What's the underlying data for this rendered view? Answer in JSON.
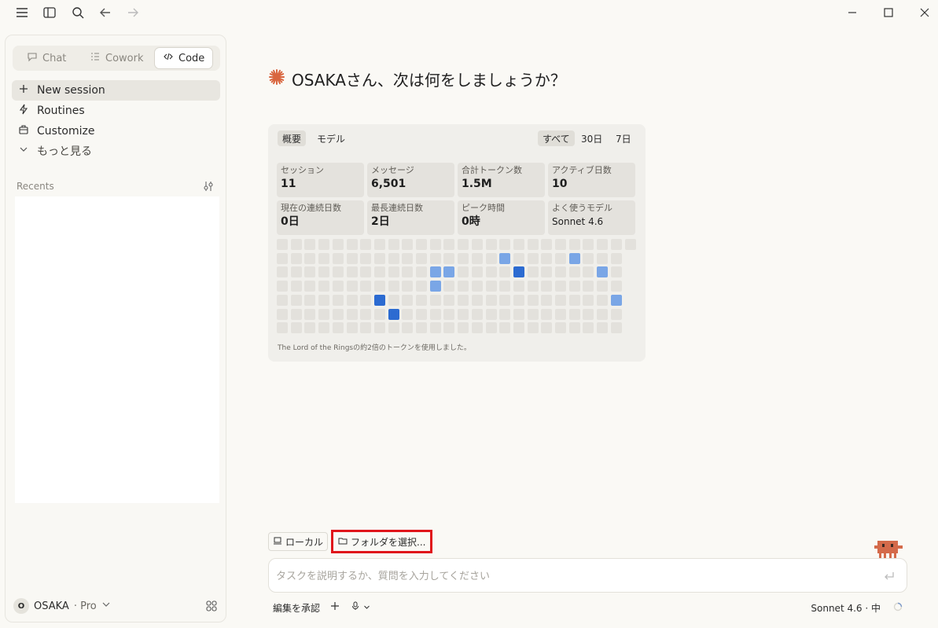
{
  "sidebar": {
    "modes": [
      {
        "label": "Chat",
        "icon": "chat-icon",
        "active": false
      },
      {
        "label": "Cowork",
        "icon": "cowork-icon",
        "active": false
      },
      {
        "label": "Code",
        "icon": "code-icon",
        "active": true
      }
    ],
    "items": [
      {
        "label": "New session",
        "icon": "plus-icon"
      },
      {
        "label": "Routines",
        "icon": "lightning-icon"
      },
      {
        "label": "Customize",
        "icon": "briefcase-icon"
      },
      {
        "label": "もっと見る",
        "icon": "chevron-down-icon"
      }
    ],
    "recents_label": "Recents",
    "user": {
      "initial": "O",
      "name": "OSAKA",
      "plan": "· Pro"
    }
  },
  "greeting": "OSAKAさん、次は何をしましょうか？",
  "stats": {
    "tabs_left": [
      "概要",
      "モデル"
    ],
    "tabs_right": [
      "すべて",
      "30日",
      "7日"
    ],
    "boxes": [
      {
        "label": "セッション",
        "value": "11"
      },
      {
        "label": "メッセージ",
        "value": "6,501"
      },
      {
        "label": "合計トークン数",
        "value": "1.5M"
      },
      {
        "label": "アクティブ日数",
        "value": "10"
      },
      {
        "label": "現在の連続日数",
        "value": "0日"
      },
      {
        "label": "最長連続日数",
        "value": "2日"
      },
      {
        "label": "ピーク時間",
        "value": "0時"
      },
      {
        "label": "よく使うモデル",
        "value": "Sonnet 4.6"
      }
    ],
    "footnote": "The Lord of the Ringsの約2倍のトークンを使用しました。",
    "colors": {
      "empty": "#e3e1dc",
      "light": "#7aa6e6",
      "dark": "#2c6bd1"
    }
  },
  "env": {
    "local_label": "ローカル",
    "folder_label": "フォルダを選択..."
  },
  "composer": {
    "placeholder": "タスクを説明するか、質問を入力してください"
  },
  "bottom": {
    "approve_label": "編集を承認",
    "model_label": "Sonnet 4.6 · 中"
  }
}
